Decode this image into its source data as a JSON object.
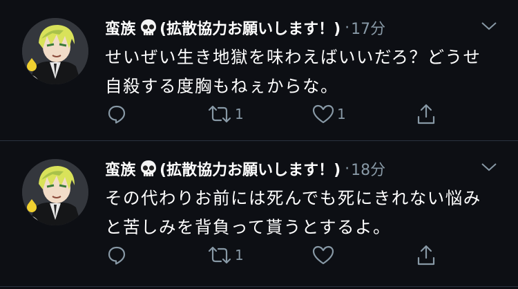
{
  "colors": {
    "background": "#0d0f14",
    "text": "#ffffff",
    "muted": "#8899a6",
    "divider": "#2b3440"
  },
  "tweets": [
    {
      "name_part1": "蛮族",
      "name_part2": "(拡散協力お願いします！)",
      "name_emoji": "skull-emoji",
      "separator": "·",
      "time": "17分",
      "text": "せいぜい生き地獄を味わえばいいだろ？どうせ自殺する度胸もねぇからな。",
      "actions": {
        "reply_icon": "reply-icon",
        "reply_count": "",
        "retweet_icon": "retweet-icon",
        "retweet_count": "1",
        "like_icon": "heart-icon",
        "like_count": "1",
        "share_icon": "share-icon"
      }
    },
    {
      "name_part1": "蛮族",
      "name_part2": "(拡散協力お願いします！)",
      "name_emoji": "skull-emoji",
      "separator": "·",
      "time": "18分",
      "text": "その代わりお前には死んでも死にきれない悩みと苦しみを背負って貰うとするよ。",
      "actions": {
        "reply_icon": "reply-icon",
        "reply_count": "",
        "retweet_icon": "retweet-icon",
        "retweet_count": "1",
        "like_icon": "heart-icon",
        "like_count": "",
        "share_icon": "share-icon"
      }
    }
  ]
}
